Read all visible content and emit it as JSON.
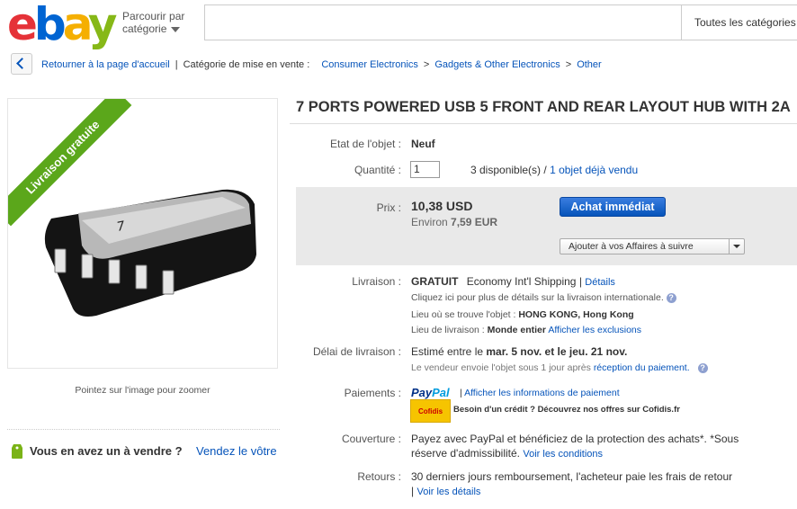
{
  "header": {
    "logo": [
      "e",
      "b",
      "a",
      "y"
    ],
    "browse_line1": "Parcourir par",
    "browse_line2": "catégorie",
    "search_placeholder": "",
    "search_category": "Toutes les catégories"
  },
  "breadcrumb": {
    "back": "Retourner à la page d'accueil",
    "category_label": "Catégorie de mise en vente :",
    "items": [
      "Consumer Electronics",
      "Gadgets & Other Electronics",
      "Other"
    ],
    "separator": ">"
  },
  "gallery": {
    "ribbon": "Livraison gratuite",
    "zoom_hint": "Pointez sur l'image pour zoomer",
    "hub_brand": "7",
    "sell_question": "Vous en avez un à vendre ?",
    "sell_link": "Vendez le vôtre"
  },
  "item": {
    "title": "7 PORTS POWERED USB 5 FRONT AND REAR LAYOUT HUB WITH 2A",
    "condition_label": "Etat de l'objet :",
    "condition_value": "Neuf",
    "quantity_label": "Quantité :",
    "quantity_value": "1",
    "available": "3 disponible(s)",
    "sold_sep": "/",
    "sold_link": "1 objet déjà vendu",
    "price_label": "Prix :",
    "price": "10,38 USD",
    "approx_prefix": "Environ",
    "approx_value": "7,59 EUR",
    "buy_button": "Achat immédiat",
    "watch_button": "Ajouter à vos Affaires à suivre"
  },
  "shipping": {
    "label": "Livraison :",
    "free": "GRATUIT",
    "service": "Economy Int'l Shipping",
    "pipe": "|",
    "details_link": "Détails",
    "intl_note": "Cliquez ici pour plus de détails sur la livraison internationale.",
    "location_label": "Lieu où se trouve l'objet :",
    "location_value": "HONG KONG, Hong Kong",
    "ships_to_label": "Lieu de livraison :",
    "ships_to_value": "Monde entier",
    "exclusions_link": "Afficher les exclusions"
  },
  "delivery": {
    "label": "Délai de livraison :",
    "prefix": "Estimé entre le",
    "range": "mar. 5 nov. et le jeu. 21 nov.",
    "note": "Le vendeur envoie l'objet sous 1 jour après",
    "note_link": "réception du paiement."
  },
  "payments": {
    "label": "Paiements :",
    "paypal_pay": "Pay",
    "paypal_pal": "Pal",
    "info_link": "Afficher les informations de paiement",
    "cofidis": "Cofidis",
    "credit": "Besoin d'un crédit ? Découvrez nos offres sur Cofidis.fr"
  },
  "coverage": {
    "label": "Couverture :",
    "line1": "Payez avec PayPal et bénéficiez de la protection des achats*. *Sous",
    "line2": "réserve d'admissibilité.",
    "link": "Voir les conditions"
  },
  "returns": {
    "label": "Retours :",
    "text": "30 derniers jours remboursement, l'acheteur paie les frais de retour",
    "link": "Voir les détails"
  },
  "colors": {
    "link": "#0654ba",
    "ribbon": "#5ba71b",
    "price_box": "#e9e9e9",
    "buy_button": "#0654ba"
  }
}
